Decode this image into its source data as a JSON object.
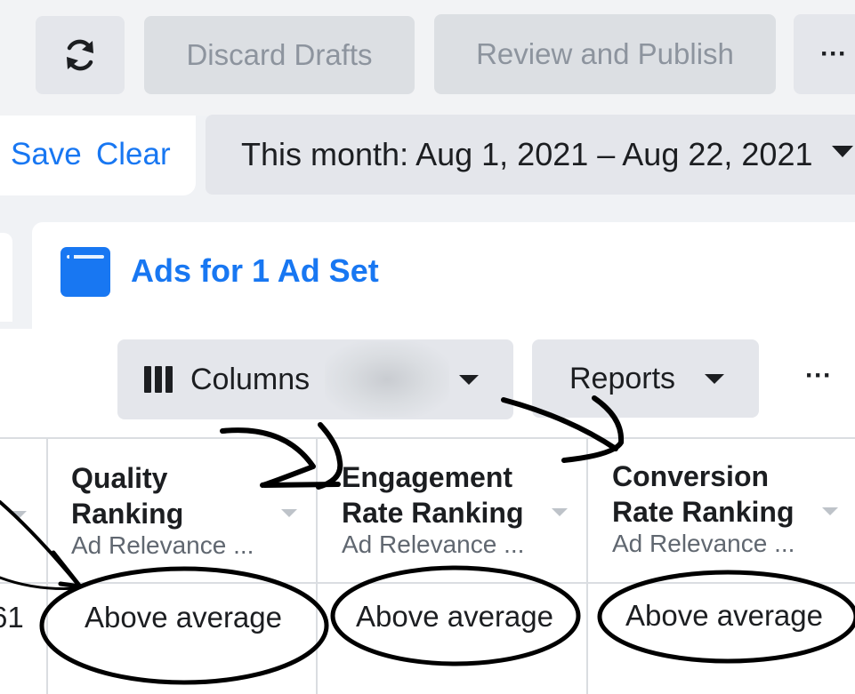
{
  "toolbar": {
    "refresh_icon": "refresh-icon",
    "discard_label": "Discard Drafts",
    "publish_label": "Review and Publish",
    "more_label": "···"
  },
  "filters": {
    "save_label": "Save",
    "clear_label": "Clear",
    "date_range": "This month: Aug 1, 2021 – Aug 22, 2021"
  },
  "tab": {
    "title": "Ads for 1 Ad Set",
    "icon": "ad-window-icon"
  },
  "controls": {
    "columns_label": "Columns",
    "reports_label": "Reports",
    "more_label": "···"
  },
  "table": {
    "partial_left_value": "61",
    "columns": [
      {
        "title_line1": "Quality",
        "title_line2": "Ranking",
        "subtitle": "Ad Relevance ...",
        "value": "Above average"
      },
      {
        "title_line1": "Engagement",
        "title_line2": "Rate Ranking",
        "subtitle": "Ad Relevance ...",
        "value": "Above average"
      },
      {
        "title_line1": "Conversion",
        "title_line2": "Rate Ranking",
        "subtitle": "Ad Relevance ...",
        "value": "Above average"
      }
    ]
  },
  "colors": {
    "accent": "#1877f2",
    "button_bg": "#e4e6eb",
    "annotation_ink": "#000000"
  }
}
